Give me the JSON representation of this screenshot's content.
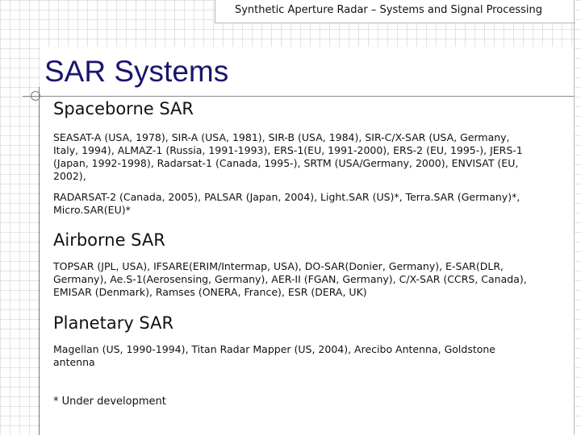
{
  "header": {
    "text": "Synthetic Aperture Radar – Systems and Signal Processing"
  },
  "slide": {
    "title": "SAR Systems",
    "sections": [
      {
        "heading": "Spaceborne SAR",
        "paragraphs": [
          "SEASAT-A (USA, 1978), SIR-A (USA, 1981), SIR-B (USA, 1984), SIR-C/X-SAR (USA, Germany, Italy, 1994), ALMAZ-1 (Russia, 1991-1993), ERS-1(EU, 1991-2000), ERS-2 (EU, 1995-), JERS-1 (Japan, 1992-1998), Radarsat-1 (Canada, 1995-), SRTM (USA/Germany, 2000), ENVISAT (EU, 2002),",
          "RADARSAT-2 (Canada, 2005), PALSAR (Japan, 2004), Light.SAR (US)*, Terra.SAR (Germany)*, Micro.SAR(EU)*"
        ]
      },
      {
        "heading": "Airborne SAR",
        "paragraphs": [
          "TOPSAR (JPL, USA), IFSARE(ERIM/Intermap, USA), DO-SAR(Donier, Germany), E-SAR(DLR, Germany), Ae.S-1(Aerosensing, Germany), AER-II (FGAN, Germany), C/X-SAR (CCRS, Canada), EMISAR (Denmark), Ramses (ONERA, France), ESR (DERA, UK)"
        ]
      },
      {
        "heading": "Planetary SAR",
        "paragraphs": [
          "Magellan (US, 1990-1994), Titan Radar Mapper (US, 2004), Arecibo Antenna, Goldstone antenna"
        ]
      }
    ],
    "footnote": "* Under development"
  }
}
